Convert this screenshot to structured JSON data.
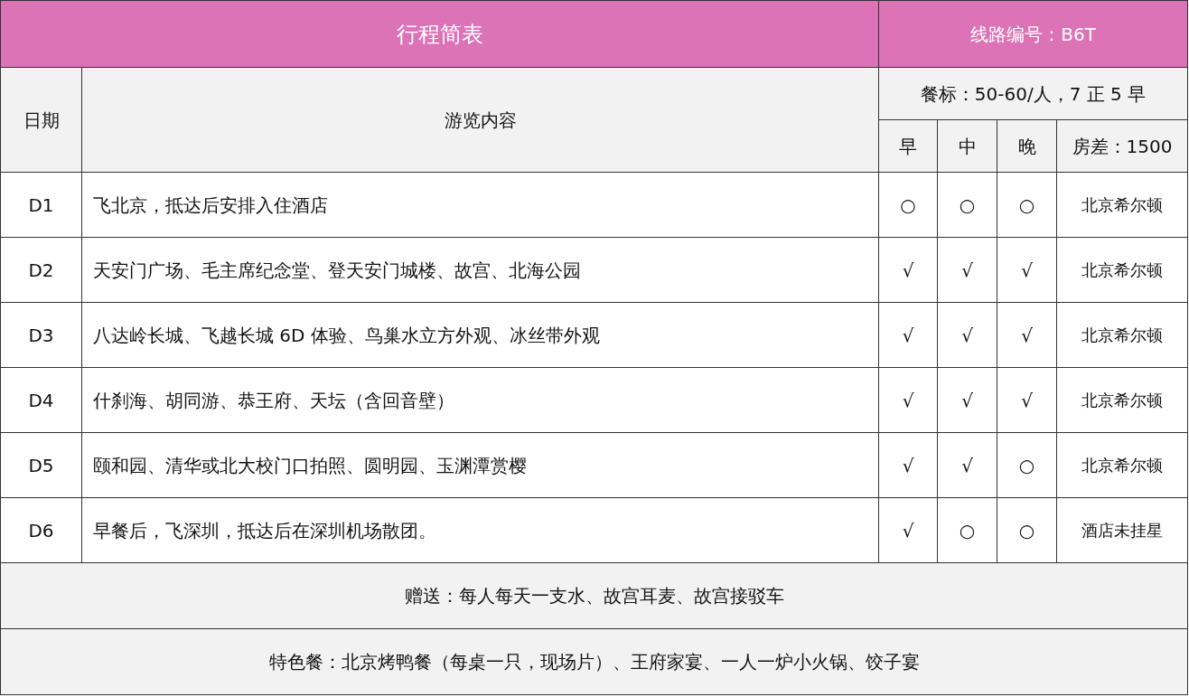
{
  "title": "行程简表",
  "route_code": "线路编号：B6T",
  "columns": {
    "date": "日期",
    "content": "游览内容",
    "meal_standard": "餐标：50-60/人，7 正 5 早",
    "meals": [
      "早",
      "中",
      "晚"
    ],
    "room_diff": "房差：1500"
  },
  "days": [
    {
      "day": "D1",
      "content": "飞北京，抵达后安排入住酒店",
      "meals": [
        "○",
        "○",
        "○"
      ],
      "hotel": "北京希尔顿"
    },
    {
      "day": "D2",
      "content": "天安门广场、毛主席纪念堂、登天安门城楼、故宫、北海公园",
      "meals": [
        "√",
        "√",
        "√"
      ],
      "hotel": "北京希尔顿"
    },
    {
      "day": "D3",
      "content": "八达岭长城、飞越长城 6D 体验、鸟巢水立方外观、冰丝带外观",
      "meals": [
        "√",
        "√",
        "√"
      ],
      "hotel": "北京希尔顿"
    },
    {
      "day": "D4",
      "content": "什刹海、胡同游、恭王府、天坛（含回音壁）",
      "meals": [
        "√",
        "√",
        "√"
      ],
      "hotel": "北京希尔顿"
    },
    {
      "day": "D5",
      "content": "颐和园、清华或北大校门口拍照、圆明园、玉渊潭赏樱",
      "meals": [
        "√",
        "√",
        "○"
      ],
      "hotel": "北京希尔顿"
    },
    {
      "day": "D6",
      "content": "早餐后，飞深圳，抵达后在深圳机场散团。",
      "meals": [
        "√",
        "○",
        "○"
      ],
      "hotel": "酒店未挂星"
    }
  ],
  "notes": [
    "赠送：每人每天一支水、故宫耳麦、故宫接驳车",
    "特色餐：北京烤鸭餐（每桌一只，现场片）、王府家宴、一人一炉小火锅、饺子宴"
  ]
}
